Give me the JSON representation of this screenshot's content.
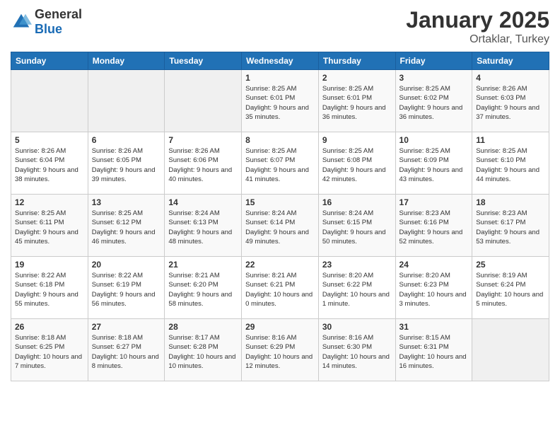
{
  "logo": {
    "general": "General",
    "blue": "Blue"
  },
  "header": {
    "month": "January 2025",
    "location": "Ortaklar, Turkey"
  },
  "weekdays": [
    "Sunday",
    "Monday",
    "Tuesday",
    "Wednesday",
    "Thursday",
    "Friday",
    "Saturday"
  ],
  "weeks": [
    [
      {
        "day": "",
        "sunrise": "",
        "sunset": "",
        "daylight": ""
      },
      {
        "day": "",
        "sunrise": "",
        "sunset": "",
        "daylight": ""
      },
      {
        "day": "",
        "sunrise": "",
        "sunset": "",
        "daylight": ""
      },
      {
        "day": "1",
        "sunrise": "Sunrise: 8:25 AM",
        "sunset": "Sunset: 6:01 PM",
        "daylight": "Daylight: 9 hours and 35 minutes."
      },
      {
        "day": "2",
        "sunrise": "Sunrise: 8:25 AM",
        "sunset": "Sunset: 6:01 PM",
        "daylight": "Daylight: 9 hours and 36 minutes."
      },
      {
        "day": "3",
        "sunrise": "Sunrise: 8:25 AM",
        "sunset": "Sunset: 6:02 PM",
        "daylight": "Daylight: 9 hours and 36 minutes."
      },
      {
        "day": "4",
        "sunrise": "Sunrise: 8:26 AM",
        "sunset": "Sunset: 6:03 PM",
        "daylight": "Daylight: 9 hours and 37 minutes."
      }
    ],
    [
      {
        "day": "5",
        "sunrise": "Sunrise: 8:26 AM",
        "sunset": "Sunset: 6:04 PM",
        "daylight": "Daylight: 9 hours and 38 minutes."
      },
      {
        "day": "6",
        "sunrise": "Sunrise: 8:26 AM",
        "sunset": "Sunset: 6:05 PM",
        "daylight": "Daylight: 9 hours and 39 minutes."
      },
      {
        "day": "7",
        "sunrise": "Sunrise: 8:26 AM",
        "sunset": "Sunset: 6:06 PM",
        "daylight": "Daylight: 9 hours and 40 minutes."
      },
      {
        "day": "8",
        "sunrise": "Sunrise: 8:25 AM",
        "sunset": "Sunset: 6:07 PM",
        "daylight": "Daylight: 9 hours and 41 minutes."
      },
      {
        "day": "9",
        "sunrise": "Sunrise: 8:25 AM",
        "sunset": "Sunset: 6:08 PM",
        "daylight": "Daylight: 9 hours and 42 minutes."
      },
      {
        "day": "10",
        "sunrise": "Sunrise: 8:25 AM",
        "sunset": "Sunset: 6:09 PM",
        "daylight": "Daylight: 9 hours and 43 minutes."
      },
      {
        "day": "11",
        "sunrise": "Sunrise: 8:25 AM",
        "sunset": "Sunset: 6:10 PM",
        "daylight": "Daylight: 9 hours and 44 minutes."
      }
    ],
    [
      {
        "day": "12",
        "sunrise": "Sunrise: 8:25 AM",
        "sunset": "Sunset: 6:11 PM",
        "daylight": "Daylight: 9 hours and 45 minutes."
      },
      {
        "day": "13",
        "sunrise": "Sunrise: 8:25 AM",
        "sunset": "Sunset: 6:12 PM",
        "daylight": "Daylight: 9 hours and 46 minutes."
      },
      {
        "day": "14",
        "sunrise": "Sunrise: 8:24 AM",
        "sunset": "Sunset: 6:13 PM",
        "daylight": "Daylight: 9 hours and 48 minutes."
      },
      {
        "day": "15",
        "sunrise": "Sunrise: 8:24 AM",
        "sunset": "Sunset: 6:14 PM",
        "daylight": "Daylight: 9 hours and 49 minutes."
      },
      {
        "day": "16",
        "sunrise": "Sunrise: 8:24 AM",
        "sunset": "Sunset: 6:15 PM",
        "daylight": "Daylight: 9 hours and 50 minutes."
      },
      {
        "day": "17",
        "sunrise": "Sunrise: 8:23 AM",
        "sunset": "Sunset: 6:16 PM",
        "daylight": "Daylight: 9 hours and 52 minutes."
      },
      {
        "day": "18",
        "sunrise": "Sunrise: 8:23 AM",
        "sunset": "Sunset: 6:17 PM",
        "daylight": "Daylight: 9 hours and 53 minutes."
      }
    ],
    [
      {
        "day": "19",
        "sunrise": "Sunrise: 8:22 AM",
        "sunset": "Sunset: 6:18 PM",
        "daylight": "Daylight: 9 hours and 55 minutes."
      },
      {
        "day": "20",
        "sunrise": "Sunrise: 8:22 AM",
        "sunset": "Sunset: 6:19 PM",
        "daylight": "Daylight: 9 hours and 56 minutes."
      },
      {
        "day": "21",
        "sunrise": "Sunrise: 8:21 AM",
        "sunset": "Sunset: 6:20 PM",
        "daylight": "Daylight: 9 hours and 58 minutes."
      },
      {
        "day": "22",
        "sunrise": "Sunrise: 8:21 AM",
        "sunset": "Sunset: 6:21 PM",
        "daylight": "Daylight: 10 hours and 0 minutes."
      },
      {
        "day": "23",
        "sunrise": "Sunrise: 8:20 AM",
        "sunset": "Sunset: 6:22 PM",
        "daylight": "Daylight: 10 hours and 1 minute."
      },
      {
        "day": "24",
        "sunrise": "Sunrise: 8:20 AM",
        "sunset": "Sunset: 6:23 PM",
        "daylight": "Daylight: 10 hours and 3 minutes."
      },
      {
        "day": "25",
        "sunrise": "Sunrise: 8:19 AM",
        "sunset": "Sunset: 6:24 PM",
        "daylight": "Daylight: 10 hours and 5 minutes."
      }
    ],
    [
      {
        "day": "26",
        "sunrise": "Sunrise: 8:18 AM",
        "sunset": "Sunset: 6:25 PM",
        "daylight": "Daylight: 10 hours and 7 minutes."
      },
      {
        "day": "27",
        "sunrise": "Sunrise: 8:18 AM",
        "sunset": "Sunset: 6:27 PM",
        "daylight": "Daylight: 10 hours and 8 minutes."
      },
      {
        "day": "28",
        "sunrise": "Sunrise: 8:17 AM",
        "sunset": "Sunset: 6:28 PM",
        "daylight": "Daylight: 10 hours and 10 minutes."
      },
      {
        "day": "29",
        "sunrise": "Sunrise: 8:16 AM",
        "sunset": "Sunset: 6:29 PM",
        "daylight": "Daylight: 10 hours and 12 minutes."
      },
      {
        "day": "30",
        "sunrise": "Sunrise: 8:16 AM",
        "sunset": "Sunset: 6:30 PM",
        "daylight": "Daylight: 10 hours and 14 minutes."
      },
      {
        "day": "31",
        "sunrise": "Sunrise: 8:15 AM",
        "sunset": "Sunset: 6:31 PM",
        "daylight": "Daylight: 10 hours and 16 minutes."
      },
      {
        "day": "",
        "sunrise": "",
        "sunset": "",
        "daylight": ""
      }
    ]
  ]
}
